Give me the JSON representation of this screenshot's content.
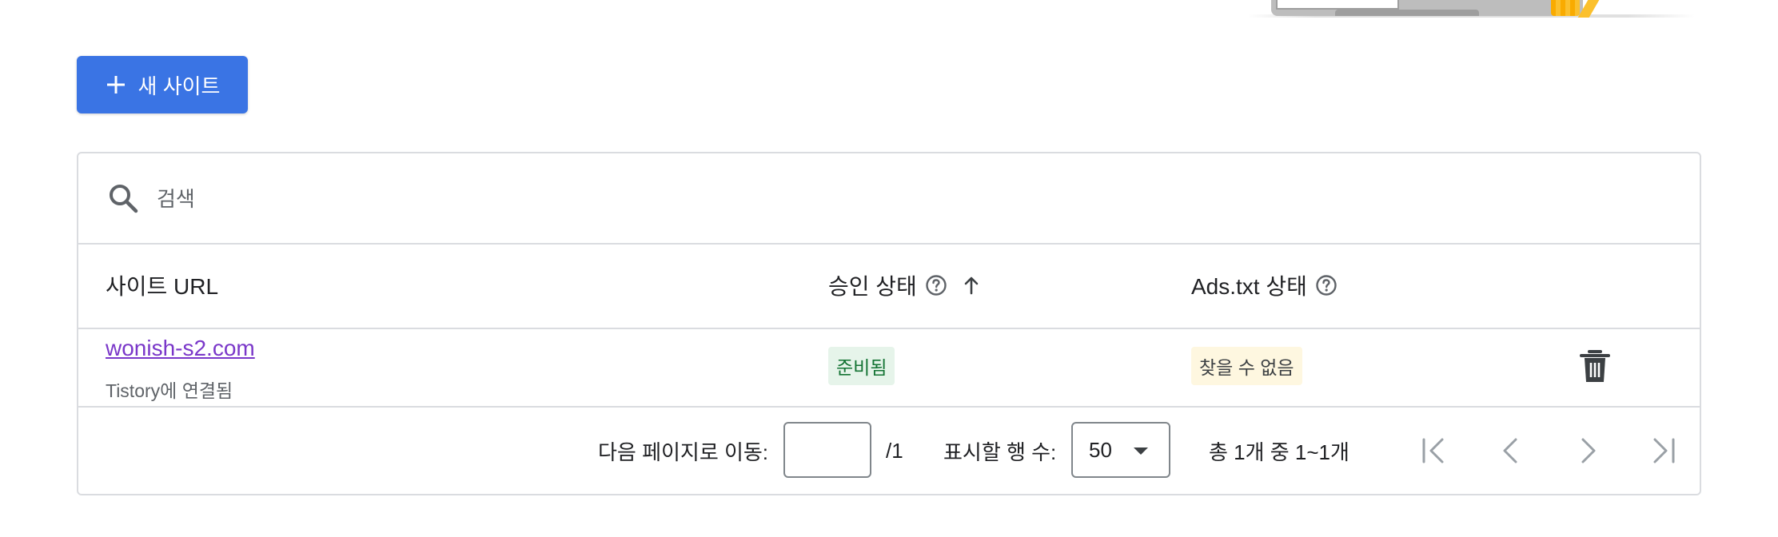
{
  "actions": {
    "add_site_label": "새 사이트"
  },
  "search": {
    "placeholder": "검색"
  },
  "table": {
    "columns": {
      "site_url": "사이트 URL",
      "approval_status": "승인 상태",
      "ads_txt_status": "Ads.txt 상태"
    },
    "rows": [
      {
        "site": "wonish-s2.com",
        "subtitle": "Tistory에 연결됨",
        "approval_status": "준비됨",
        "ads_txt_status": "찾을 수 없음"
      }
    ]
  },
  "pagination": {
    "goto_label": "다음 페이지로 이동:",
    "goto_value": "",
    "total_pages": "/1",
    "rows_label": "표시할 행 수:",
    "rows_value": "50",
    "range_label": "총 1개 중 1~1개"
  },
  "colors": {
    "primary_button": "#3a74e4",
    "link": "#7a37c9",
    "ready_chip_bg": "#e6f4ea",
    "ready_chip_text": "#137333",
    "notfound_chip_bg": "#fef7e0",
    "border": "#dadce0"
  },
  "icons": {
    "add": "plus-icon",
    "search": "search-icon",
    "help": "help-circle-icon",
    "sort": "arrow-up-icon",
    "delete": "trash-icon",
    "first_page": "first-page-icon",
    "prev_page": "chevron-left-icon",
    "next_page": "chevron-right-icon",
    "last_page": "last-page-icon",
    "dropdown": "caret-down-icon"
  }
}
